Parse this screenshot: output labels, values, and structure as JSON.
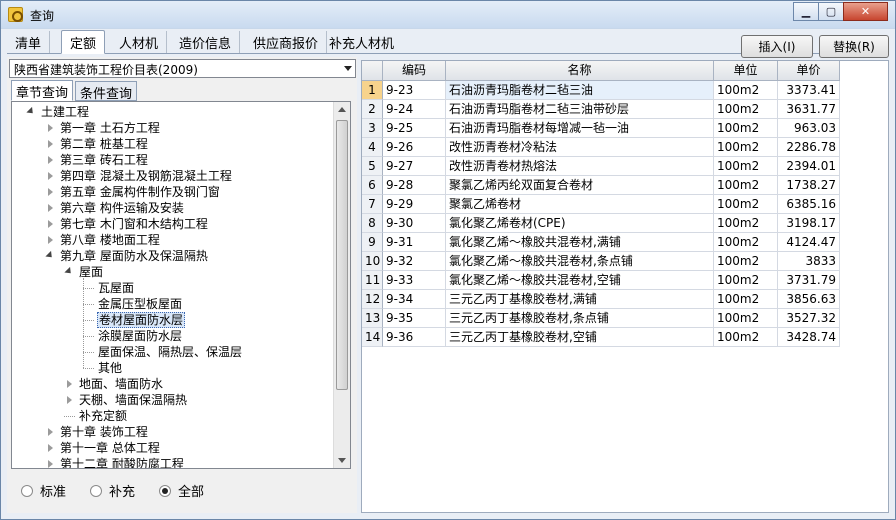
{
  "window": {
    "title": "查询"
  },
  "tabs": [
    "清单",
    "定额",
    "人材机",
    "造价信息",
    "供应商报价",
    "补充人材机"
  ],
  "active_tab": 1,
  "actions": {
    "insert_label": "插入(I)",
    "replace_label": "替换(R)"
  },
  "catalog": {
    "selected": "陕西省建筑装饰工程价目表(2009)"
  },
  "subtabs": [
    "章节查询",
    "条件查询"
  ],
  "tree": [
    {
      "label": "土建工程",
      "level": 0,
      "state": "open"
    },
    {
      "label": "第一章 土石方工程",
      "level": 1,
      "state": "closed"
    },
    {
      "label": "第二章 桩基工程",
      "level": 1,
      "state": "closed"
    },
    {
      "label": "第三章 砖石工程",
      "level": 1,
      "state": "closed"
    },
    {
      "label": "第四章 混凝土及钢筋混凝土工程",
      "level": 1,
      "state": "closed"
    },
    {
      "label": "第五章 金属构件制作及钢门窗",
      "level": 1,
      "state": "closed"
    },
    {
      "label": "第六章 构件运输及安装",
      "level": 1,
      "state": "closed"
    },
    {
      "label": "第七章 木门窗和木结构工程",
      "level": 1,
      "state": "closed"
    },
    {
      "label": "第八章 楼地面工程",
      "level": 1,
      "state": "closed"
    },
    {
      "label": "第九章 屋面防水及保温隔热",
      "level": 1,
      "state": "open"
    },
    {
      "label": "屋面",
      "level": 2,
      "state": "open"
    },
    {
      "label": "瓦屋面",
      "level": 3,
      "state": "leaf"
    },
    {
      "label": "金属压型板屋面",
      "level": 3,
      "state": "leaf"
    },
    {
      "label": "卷材屋面防水层",
      "level": 3,
      "state": "leaf",
      "selected": true
    },
    {
      "label": "涂膜屋面防水层",
      "level": 3,
      "state": "leaf"
    },
    {
      "label": "屋面保温、隔热层、保温层",
      "level": 3,
      "state": "leaf"
    },
    {
      "label": "其他",
      "level": 3,
      "state": "leaf"
    },
    {
      "label": "地面、墙面防水",
      "level": 2,
      "state": "closed"
    },
    {
      "label": "天棚、墙面保温隔热",
      "level": 2,
      "state": "closed"
    },
    {
      "label": "补充定额",
      "level": 2,
      "state": "leaf"
    },
    {
      "label": "第十章 装饰工程",
      "level": 1,
      "state": "closed"
    },
    {
      "label": "第十一章 总体工程",
      "level": 1,
      "state": "closed"
    },
    {
      "label": "第十二章 耐酸防腐工程",
      "level": 1,
      "state": "closed"
    }
  ],
  "filter": {
    "options": [
      "标准",
      "补充",
      "全部"
    ],
    "selected": 2
  },
  "table": {
    "columns": [
      "编码",
      "名称",
      "单位",
      "单价"
    ],
    "rows": [
      {
        "n": "1",
        "code": "9-23",
        "name": "石油沥青玛脂卷材二毡三油",
        "unit": "100m2",
        "price": "3373.41"
      },
      {
        "n": "2",
        "code": "9-24",
        "name": "石油沥青玛脂卷材二毡三油带砂层",
        "unit": "100m2",
        "price": "3631.77"
      },
      {
        "n": "3",
        "code": "9-25",
        "name": "石油沥青玛脂卷材每增减一毡一油",
        "unit": "100m2",
        "price": "963.03"
      },
      {
        "n": "4",
        "code": "9-26",
        "name": "改性沥青卷材冷粘法",
        "unit": "100m2",
        "price": "2286.78"
      },
      {
        "n": "5",
        "code": "9-27",
        "name": "改性沥青卷材热熔法",
        "unit": "100m2",
        "price": "2394.01"
      },
      {
        "n": "6",
        "code": "9-28",
        "name": "聚氯乙烯丙纶双面复合卷材",
        "unit": "100m2",
        "price": "1738.27"
      },
      {
        "n": "7",
        "code": "9-29",
        "name": "聚氯乙烯卷材",
        "unit": "100m2",
        "price": "6385.16"
      },
      {
        "n": "8",
        "code": "9-30",
        "name": "氯化聚乙烯卷材(CPE)",
        "unit": "100m2",
        "price": "3198.17"
      },
      {
        "n": "9",
        "code": "9-31",
        "name": "氯化聚乙烯～橡胶共混卷材,满铺",
        "unit": "100m2",
        "price": "4124.47"
      },
      {
        "n": "10",
        "code": "9-32",
        "name": "氯化聚乙烯～橡胶共混卷材,条点铺",
        "unit": "100m2",
        "price": "3833"
      },
      {
        "n": "11",
        "code": "9-33",
        "name": "氯化聚乙烯～橡胶共混卷材,空铺",
        "unit": "100m2",
        "price": "3731.79"
      },
      {
        "n": "12",
        "code": "9-34",
        "name": "三元乙丙丁基橡胶卷材,满铺",
        "unit": "100m2",
        "price": "3856.63"
      },
      {
        "n": "13",
        "code": "9-35",
        "name": "三元乙丙丁基橡胶卷材,条点铺",
        "unit": "100m2",
        "price": "3527.32"
      },
      {
        "n": "14",
        "code": "9-36",
        "name": "三元乙丙丁基橡胶卷材,空铺",
        "unit": "100m2",
        "price": "3428.74"
      }
    ],
    "active_row": 0
  }
}
